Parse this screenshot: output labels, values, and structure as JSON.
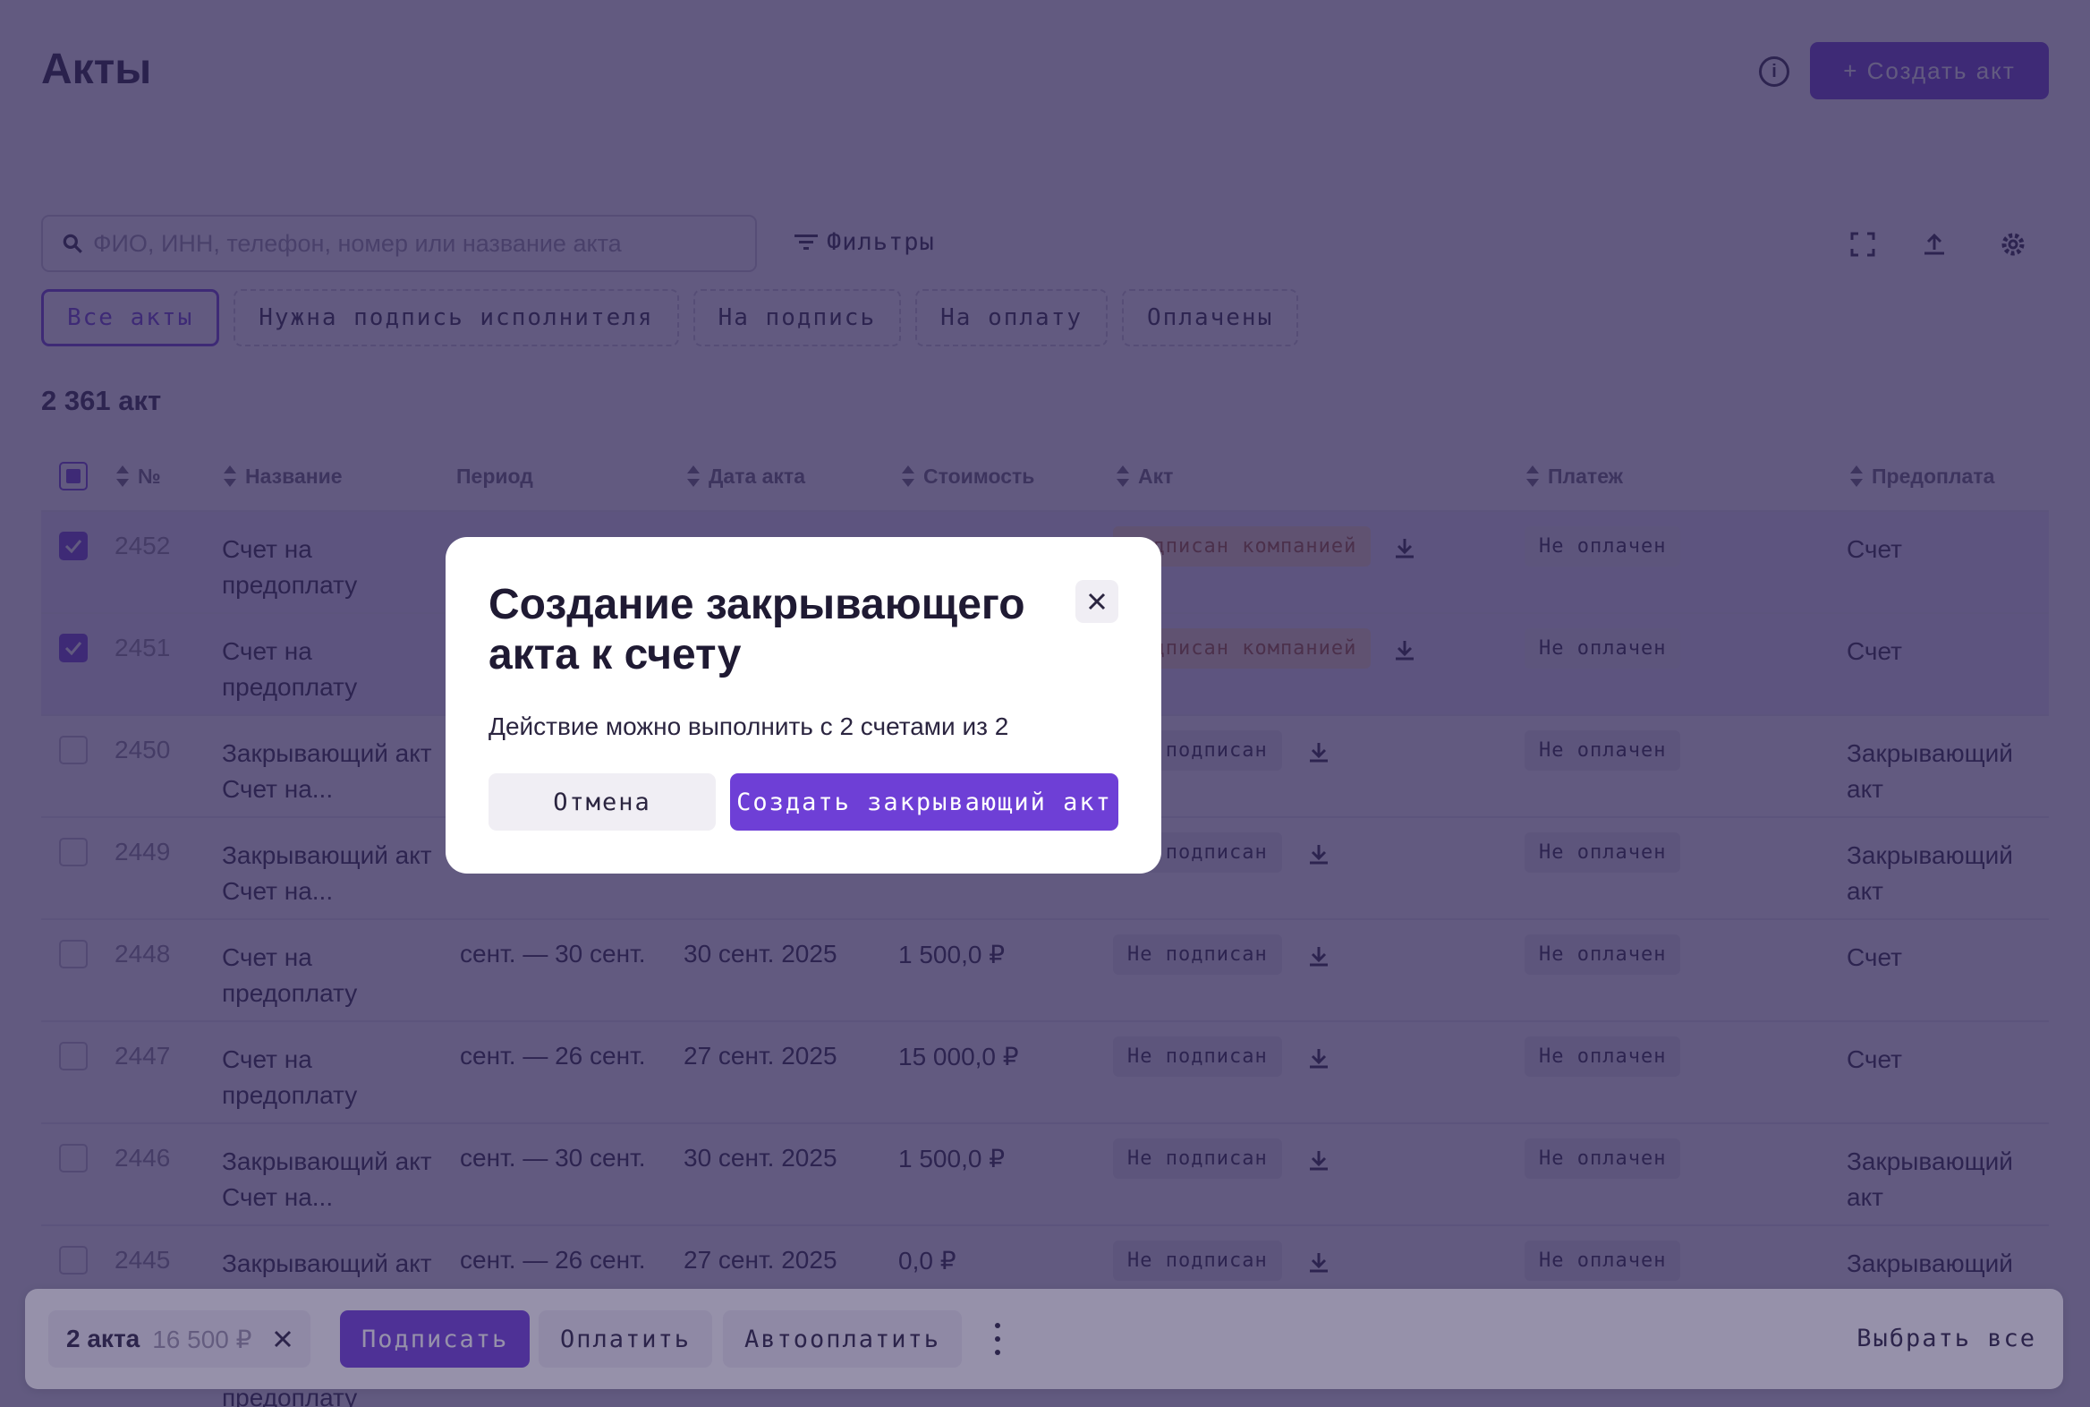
{
  "header": {
    "title": "Акты",
    "info_icon": "info-icon",
    "create_label": "+ Создать акт"
  },
  "search": {
    "placeholder": "ФИО, ИНН, телефон, номер или название акта",
    "value": ""
  },
  "filters_label": "Фильтры",
  "toolbar": {
    "icons": [
      "fullscreen-icon",
      "export-icon",
      "settings-icon"
    ]
  },
  "chips": [
    {
      "label": "Все акты",
      "active": true
    },
    {
      "label": "Нужна подпись исполнителя",
      "active": false
    },
    {
      "label": "На подпись",
      "active": false
    },
    {
      "label": "На оплату",
      "active": false
    },
    {
      "label": "Оплачены",
      "active": false
    }
  ],
  "count": "2 361 акт",
  "columns": {
    "num": "№",
    "name": "Название",
    "period": "Период",
    "date": "Дата акта",
    "cost": "Стоимость",
    "act": "Акт",
    "payment": "Платеж",
    "prepay": "Предоплата"
  },
  "rows": [
    {
      "num": "2452",
      "name1": "Счет на",
      "name2": "предоплату",
      "period": "",
      "date": "",
      "cost": "",
      "act": "подписан компанией",
      "payment": "Не оплачен",
      "prepay1": "Счет",
      "prepay2": ""
    },
    {
      "num": "2451",
      "name1": "Счет на",
      "name2": "предоплату",
      "period": "",
      "date": "",
      "cost": "",
      "act": "подписан компанией",
      "payment": "Не оплачен",
      "prepay1": "Счет",
      "prepay2": ""
    },
    {
      "num": "2450",
      "name1": "Закрывающий акт",
      "name2": "Счет на...",
      "period": "",
      "date": "",
      "cost": "",
      "act": "Не подписан",
      "payment": "Не оплачен",
      "prepay1": "Закрывающий",
      "prepay2": "акт"
    },
    {
      "num": "2449",
      "name1": "Закрывающий акт",
      "name2": "Счет на...",
      "period": "",
      "date": "",
      "cost": "",
      "act": "Не подписан",
      "payment": "Не оплачен",
      "prepay1": "Закрывающий",
      "prepay2": "акт"
    },
    {
      "num": "2448",
      "name1": "Счет на",
      "name2": "предоплату",
      "period": "сент. — 30 сент.",
      "date": "30 сент. 2025",
      "cost": "1 500,0 ₽",
      "act": "Не подписан",
      "payment": "Не оплачен",
      "prepay1": "Счет",
      "prepay2": ""
    },
    {
      "num": "2447",
      "name1": "Счет на",
      "name2": "предоплату",
      "period": "сент. — 26 сент.",
      "date": "27 сент. 2025",
      "cost": "15 000,0 ₽",
      "act": "Не подписан",
      "payment": "Не оплачен",
      "prepay1": "Счет",
      "prepay2": ""
    },
    {
      "num": "2446",
      "name1": "Закрывающий акт",
      "name2": "Счет на...",
      "period": "сент. — 30 сент.",
      "date": "30 сент. 2025",
      "cost": "1 500,0 ₽",
      "act": "Не подписан",
      "payment": "Не оплачен",
      "prepay1": "Закрывающий",
      "prepay2": "акт"
    },
    {
      "num": "2445",
      "name1": "Закрывающий акт",
      "name2": "",
      "period": "сент. — 26 сент.",
      "date": "27 сент. 2025",
      "cost": "0,0 ₽",
      "act": "Не подписан",
      "payment": "Не оплачен",
      "prepay1": "Закрывающий",
      "prepay2": ""
    }
  ],
  "overflow_text": "предоплату",
  "bottombar": {
    "selected": "2 акта",
    "amount": "16 500 ₽",
    "sign": "Подписать",
    "pay": "Оплатить",
    "autopay": "Автооплатить",
    "select_all": "Выбрать все"
  },
  "modal": {
    "title": "Создание закрывающего акта к счету",
    "text": "Действие можно выполнить с 2 счетами из 2",
    "cancel": "Отмена",
    "confirm": "Создать закрывающий акт"
  },
  "colors": {
    "accent": "#6e3fd6",
    "warn_badge": "#f7dcc4",
    "overlay": "rgba(46,36,86,0.5)"
  }
}
